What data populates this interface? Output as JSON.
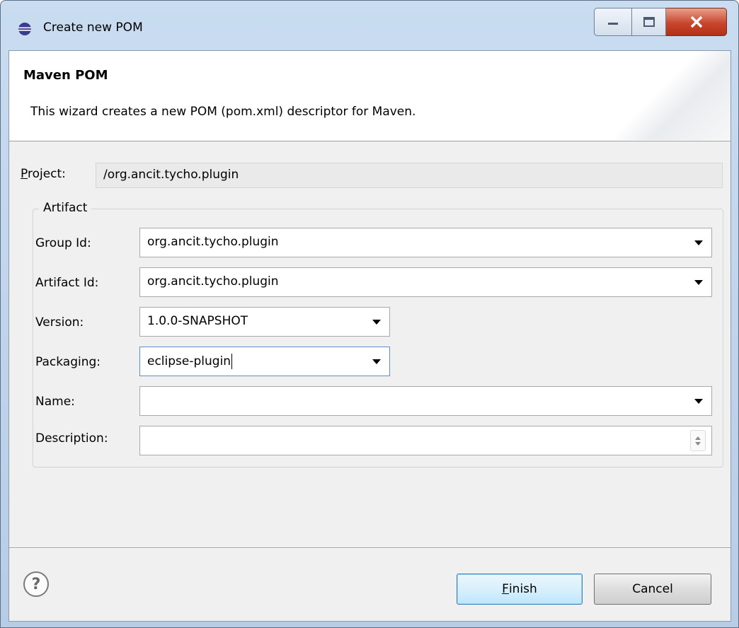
{
  "window": {
    "title": "Create new POM"
  },
  "header": {
    "title": "Maven POM",
    "description": "This wizard creates a new POM (pom.xml) descriptor for Maven."
  },
  "project": {
    "label_mnemonic": "P",
    "label_rest": "roject:",
    "value": "/org.ancit.tycho.plugin"
  },
  "artifact": {
    "group_title": "Artifact",
    "fields": {
      "group_id": {
        "label": "Group Id:",
        "value": "org.ancit.tycho.plugin"
      },
      "artifact_id": {
        "label": "Artifact Id:",
        "value": "org.ancit.tycho.plugin"
      },
      "version": {
        "label": "Version:",
        "value": "1.0.0-SNAPSHOT"
      },
      "packaging": {
        "label": "Packaging:",
        "value": "eclipse-plugin"
      },
      "name": {
        "label": "Name:",
        "value": ""
      },
      "description": {
        "label": "Description:",
        "value": ""
      }
    }
  },
  "footer": {
    "help_symbol": "?",
    "finish_mnemonic": "F",
    "finish_rest": "inish",
    "cancel_label": "Cancel"
  },
  "icons": {
    "app": "eclipse-icon",
    "minimize": "minimize-icon",
    "maximize": "maximize-icon",
    "close": "close-icon",
    "help": "help-icon",
    "dropdown": "chevron-down-icon",
    "spinner": "spinner-icon"
  },
  "colors": {
    "titlebar": "#c9dcf0",
    "close_button": "#c9462c",
    "finish_border": "#3c7fb1",
    "dialog_bg": "#f0f0f0"
  }
}
